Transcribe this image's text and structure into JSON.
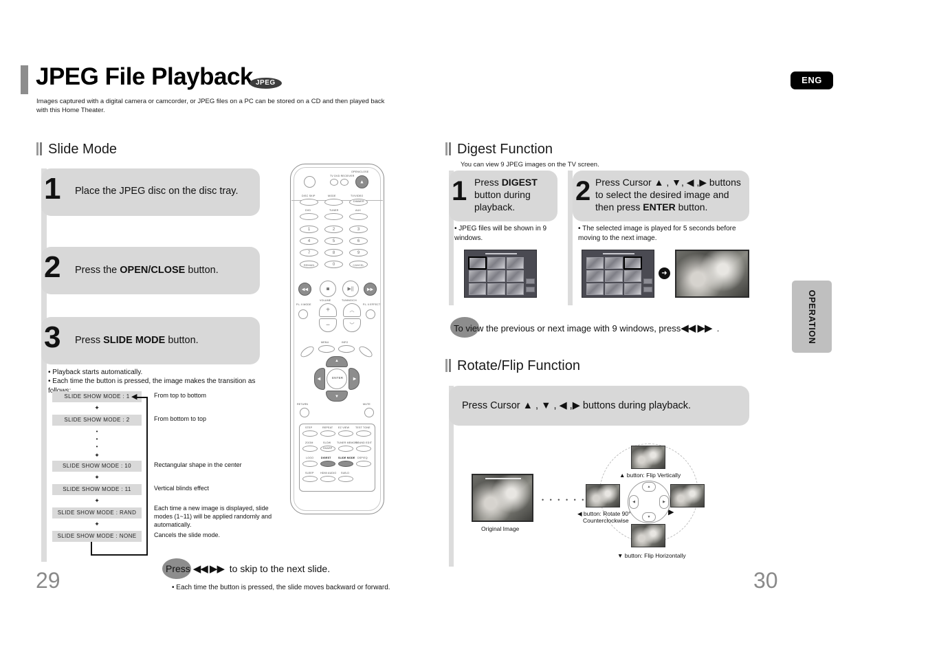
{
  "header": {
    "title": "JPEG File Playback",
    "badge": "JPEG",
    "subtitle": "Images captured with a digital camera or camcorder, or JPEG files on a PC can be stored on a CD and then played back with this Home Theater.",
    "lang_badge": "ENG"
  },
  "side_tab": {
    "label": "OPERATION"
  },
  "pages": {
    "left": "29",
    "right": "30"
  },
  "slide_mode": {
    "heading": "Slide Mode",
    "steps": [
      {
        "num": "1",
        "text_html": "Place the JPEG disc on the disc tray."
      },
      {
        "num": "2",
        "text_html": "Press the <b>OPEN/CLOSE</b> button."
      },
      {
        "num": "3",
        "text_html": "Press <b>SLIDE MODE</b> button."
      }
    ],
    "notes": [
      "Playback starts automatically.",
      "Each time the button is pressed, the image makes the transition as follows:"
    ],
    "flow": [
      {
        "label": "SLIDE SHOW MODE : 1",
        "desc": "From top to bottom"
      },
      {
        "label": "SLIDE SHOW MODE : 2",
        "desc": "From bottom to top"
      },
      {
        "label": "SLIDE SHOW MODE : 10",
        "desc": "Rectangular shape in the center"
      },
      {
        "label": "SLIDE SHOW MODE : 11",
        "desc": "Vertical blinds effect"
      },
      {
        "label": "SLIDE SHOW MODE : RAND",
        "desc": "Each time a new image is displayed, slide modes (1~11) will be applied randomly and automatically."
      },
      {
        "label": "SLIDE SHOW MODE : NONE",
        "desc": "Cancels the slide mode."
      }
    ],
    "skip_note": {
      "prefix": "Press",
      "glyph": "◀◀  ▶▶",
      "suffix": "to skip to the next slide."
    },
    "skip_bullet": "Each time the button is pressed, the slide moves backward or forward."
  },
  "digest": {
    "heading": "Digest Function",
    "subheading": "You can view 9 JPEG images on the TV screen.",
    "steps": [
      {
        "num": "1",
        "text_html": "Press <b>DIGEST</b><br>button during<br>playback.",
        "note": "JPEG files will be shown in 9 windows."
      },
      {
        "num": "2",
        "text_html": "Press Cursor &#9650; , &#9660;, &#9664; ,&#9654; buttons<br>to select the desired image and<br>then press <b>ENTER</b> button.",
        "note": "The selected image is played for 5 seconds before moving to the next image."
      }
    ],
    "footer_note": {
      "prefix": "To view the previous or next image with 9 windows, press",
      "glyph": "◀◀ ▶▶",
      "suffix": "."
    }
  },
  "rotate_flip": {
    "heading": "Rotate/Flip Function",
    "instruction_html": "Press Cursor &#9650; , &#9660; , &#9664; ,&#9654;  buttons during playback.",
    "original_caption": "Original Image",
    "captions": {
      "up": "▲ button: Flip Vertically",
      "left_line1": "◀ button: Rotate 90°",
      "left_line2": "Counterclockwise",
      "down": "▼ button: Flip Horizontally"
    }
  },
  "remote": {
    "labels": {
      "open_close": "OPEN/CLOSE",
      "tv_dvd_receiver": "TV   DVD RECEIVER",
      "disc_skip": "DISC SKIP",
      "mode": "MODE",
      "tv_video": "TV/VIDEO",
      "dimmer": "DIMMER",
      "dvd": "DVD",
      "tuner": "TUNER",
      "aux": "AUX",
      "remain": "REMAIN",
      "cancel": "CANCEL",
      "volume": "VOLUME",
      "tuning_ch": "TUNING/CH",
      "pl_mode": "P.L II MODE",
      "pl_effect": "P.L II EFFECT",
      "menu": "MENU",
      "info": "INFO",
      "enter": "ENTER",
      "return": "RETURN",
      "mute": "MUTE",
      "step": "STEP",
      "repeat": "REPEAT",
      "ez_view": "EZ VIEW",
      "test_tone": "TEST TONE",
      "zoom": "ZOOM",
      "slow": "SLOW",
      "sharp": "SHARP",
      "tuner_memory": "TUNER MEMORY",
      "sound_edit": "SOUND EDIT",
      "logo": "LOGO",
      "digest": "DIGEST",
      "slide_mode": "SLIDE MODE",
      "dsp_eq": "DSP/EQ",
      "sleep": "SLEEP",
      "hdmi_audio": "HDMI AUDIO",
      "sub_d": "SUB-D",
      "numbers": [
        "1",
        "2",
        "3",
        "4",
        "5",
        "6",
        "7",
        "8",
        "9",
        "0"
      ]
    }
  }
}
